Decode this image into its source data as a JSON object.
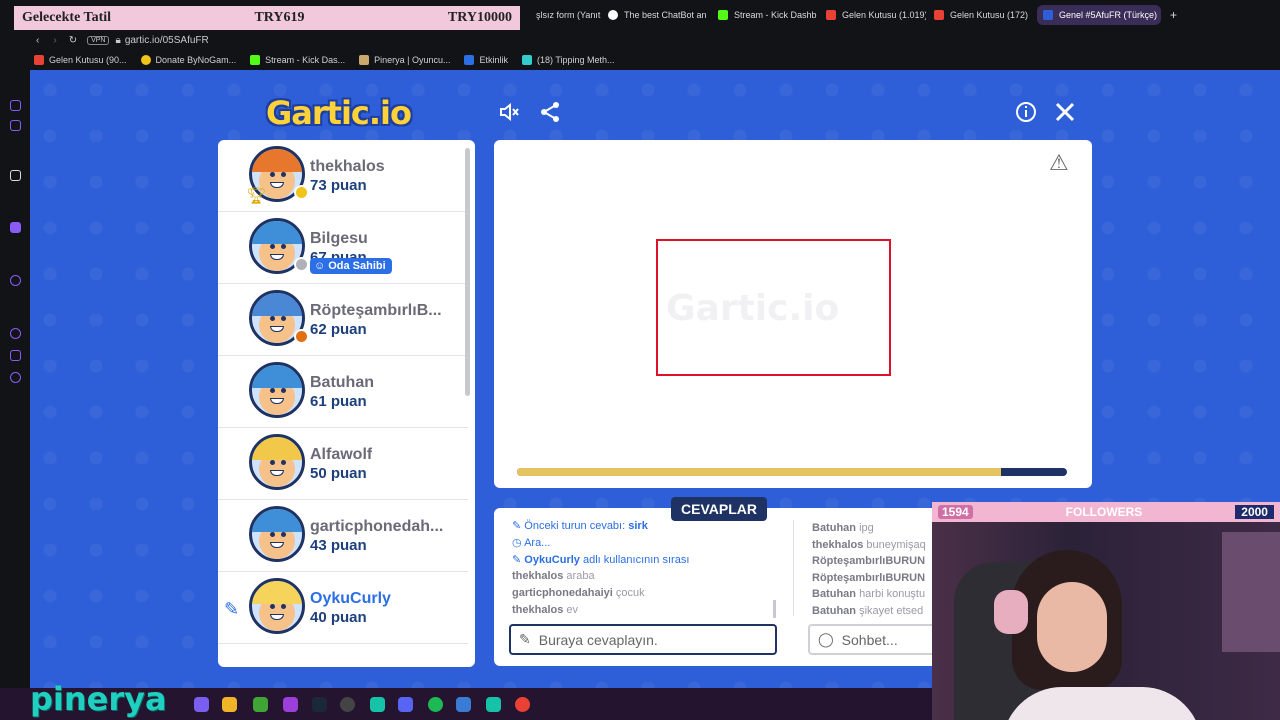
{
  "overlay": {
    "title": "Gelecekte Tatil",
    "amount_current": "TRY619",
    "amount_goal": "TRY10000"
  },
  "browser": {
    "tabs": [
      "şlsız form (Yanıt",
      "The best ChatBot an",
      "Stream - Kick Dashb",
      "Gelen Kutusu (1.019)",
      "Gelen Kutusu (172)",
      "Genel #5AfuFR (Türkçe)"
    ],
    "vpn_label": "VPN",
    "url": "gartic.io/05SAfuFR",
    "bookmarks": [
      "Gelen Kutusu (90...",
      "Donate ByNoGam...",
      "Stream - Kick Das...",
      "Pinerya | Oyuncu...",
      "Etkinlik",
      "(18) Tipping Meth..."
    ]
  },
  "game": {
    "logo": "Gartic.io",
    "watermark": "Gartic.io",
    "players": [
      {
        "name": "thekhalos",
        "score": "73 puan",
        "hair": "#e8772e",
        "status": "#f0c419",
        "trophy": true
      },
      {
        "name": "Bilgesu",
        "score": "67 puan",
        "hair": "#3f8fd8",
        "status": "#b0b0b8",
        "badge": "Oda Sahibi"
      },
      {
        "name": "RöpteşambırlıB...",
        "score": "62 puan",
        "hair": "#4a88d6",
        "status": "#e07010"
      },
      {
        "name": "Batuhan",
        "score": "61 puan",
        "hair": "#3f8fd8"
      },
      {
        "name": "Alfawolf",
        "score": "50 puan",
        "hair": "#f2c84a"
      },
      {
        "name": "garticphonedah...",
        "score": "43 puan",
        "hair": "#3f8fd8"
      },
      {
        "name": "OykuCurly",
        "score": "40 puan",
        "hair": "#f6d35a",
        "drawing": true
      }
    ],
    "timer_progress": 0.88,
    "answers_tab": "CEVAPLAR",
    "answer_log": [
      {
        "text": "Önceki turun cevabı:",
        "bold": "sirk",
        "system": true
      },
      {
        "text": "Ara...",
        "bold": "",
        "system": true
      },
      {
        "text": "adlı kullanıcının sırası",
        "bold": "OykuCurly",
        "system": true
      },
      {
        "bold": "thekhalos",
        "text": "araba"
      },
      {
        "bold": "garticphonedahaiyi",
        "text": "çocuk"
      },
      {
        "bold": "thekhalos",
        "text": "ev"
      }
    ],
    "chat_log": [
      {
        "bold": "Batuhan",
        "text": "ipg"
      },
      {
        "bold": "thekhalos",
        "text": "buneymişaq"
      },
      {
        "bold": "RöpteşambırlıBURUN",
        "text": ""
      },
      {
        "bold": "RöpteşambırlıBURUN",
        "text": ""
      },
      {
        "bold": "Batuhan",
        "text": "harbi konuştu"
      },
      {
        "bold": "Batuhan",
        "text": "şikayet etsed"
      }
    ],
    "answer_placeholder": "Buraya cevaplayın.",
    "chat_placeholder": "Sohbet..."
  },
  "stream": {
    "followers_current": "1594",
    "followers_label": "FOLLOWERS",
    "followers_goal": "2000",
    "brand": "pinerya"
  }
}
